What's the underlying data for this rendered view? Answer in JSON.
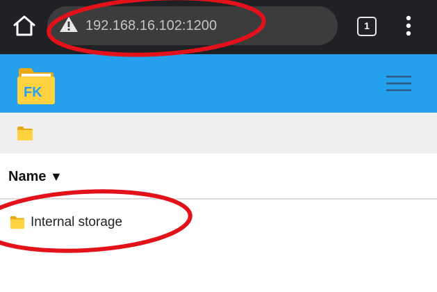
{
  "browser": {
    "url": "192.168.16.102:1200",
    "tab_count": "1",
    "home_icon": "home-icon",
    "security_icon": "warning-triangle-icon",
    "menu_icon": "more-vertical-icon"
  },
  "app": {
    "logo_text": "FK",
    "header_color": "#24a0ed",
    "menu_icon": "hamburger-menu-icon"
  },
  "breadcrumb": {
    "root_icon": "folder-icon"
  },
  "file_list": {
    "column_header": "Name",
    "sort_indicator": "▼",
    "items": [
      {
        "name": "Internal storage",
        "icon": "folder-icon"
      }
    ]
  },
  "annotations": {
    "color": "#e3121a"
  }
}
